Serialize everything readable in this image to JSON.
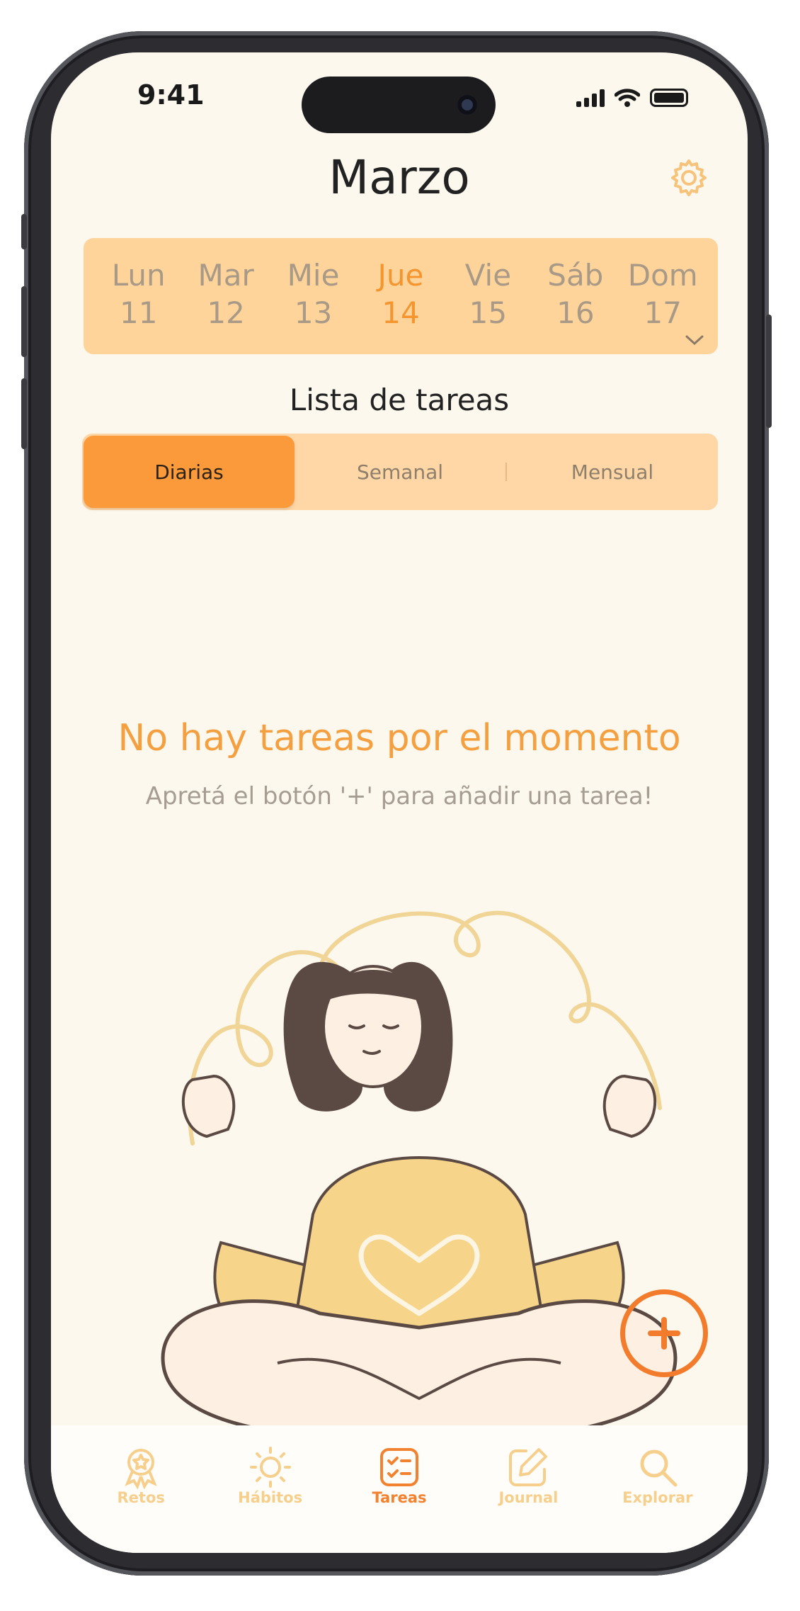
{
  "status_bar": {
    "time": "9:41"
  },
  "header": {
    "title": "Marzo"
  },
  "week": {
    "days": [
      {
        "name": "Lun",
        "date": "11"
      },
      {
        "name": "Mar",
        "date": "12"
      },
      {
        "name": "Mie",
        "date": "13"
      },
      {
        "name": "Jue",
        "date": "14",
        "active": true
      },
      {
        "name": "Vie",
        "date": "15"
      },
      {
        "name": "Sáb",
        "date": "16"
      },
      {
        "name": "Dom",
        "date": "17"
      }
    ]
  },
  "tasks": {
    "title": "Lista de tareas",
    "segments": [
      "Diarias",
      "Semanal",
      "Mensual"
    ],
    "selected_segment": "Diarias"
  },
  "empty_state": {
    "title": "No hay tareas por el momento",
    "subtitle": "Apretá el botón '+' para añadir una tarea!"
  },
  "tabbar": {
    "items": [
      {
        "label": "Retos",
        "icon": "award-icon"
      },
      {
        "label": "Hábitos",
        "icon": "sun-icon"
      },
      {
        "label": "Tareas",
        "icon": "checklist-icon",
        "active": true
      },
      {
        "label": "Journal",
        "icon": "edit-icon"
      },
      {
        "label": "Explorar",
        "icon": "search-icon"
      }
    ]
  },
  "colors": {
    "accent": "#f59530",
    "background": "#fdf8ee",
    "week_strip": "#ffd49a",
    "fab": "#f27c2c"
  }
}
